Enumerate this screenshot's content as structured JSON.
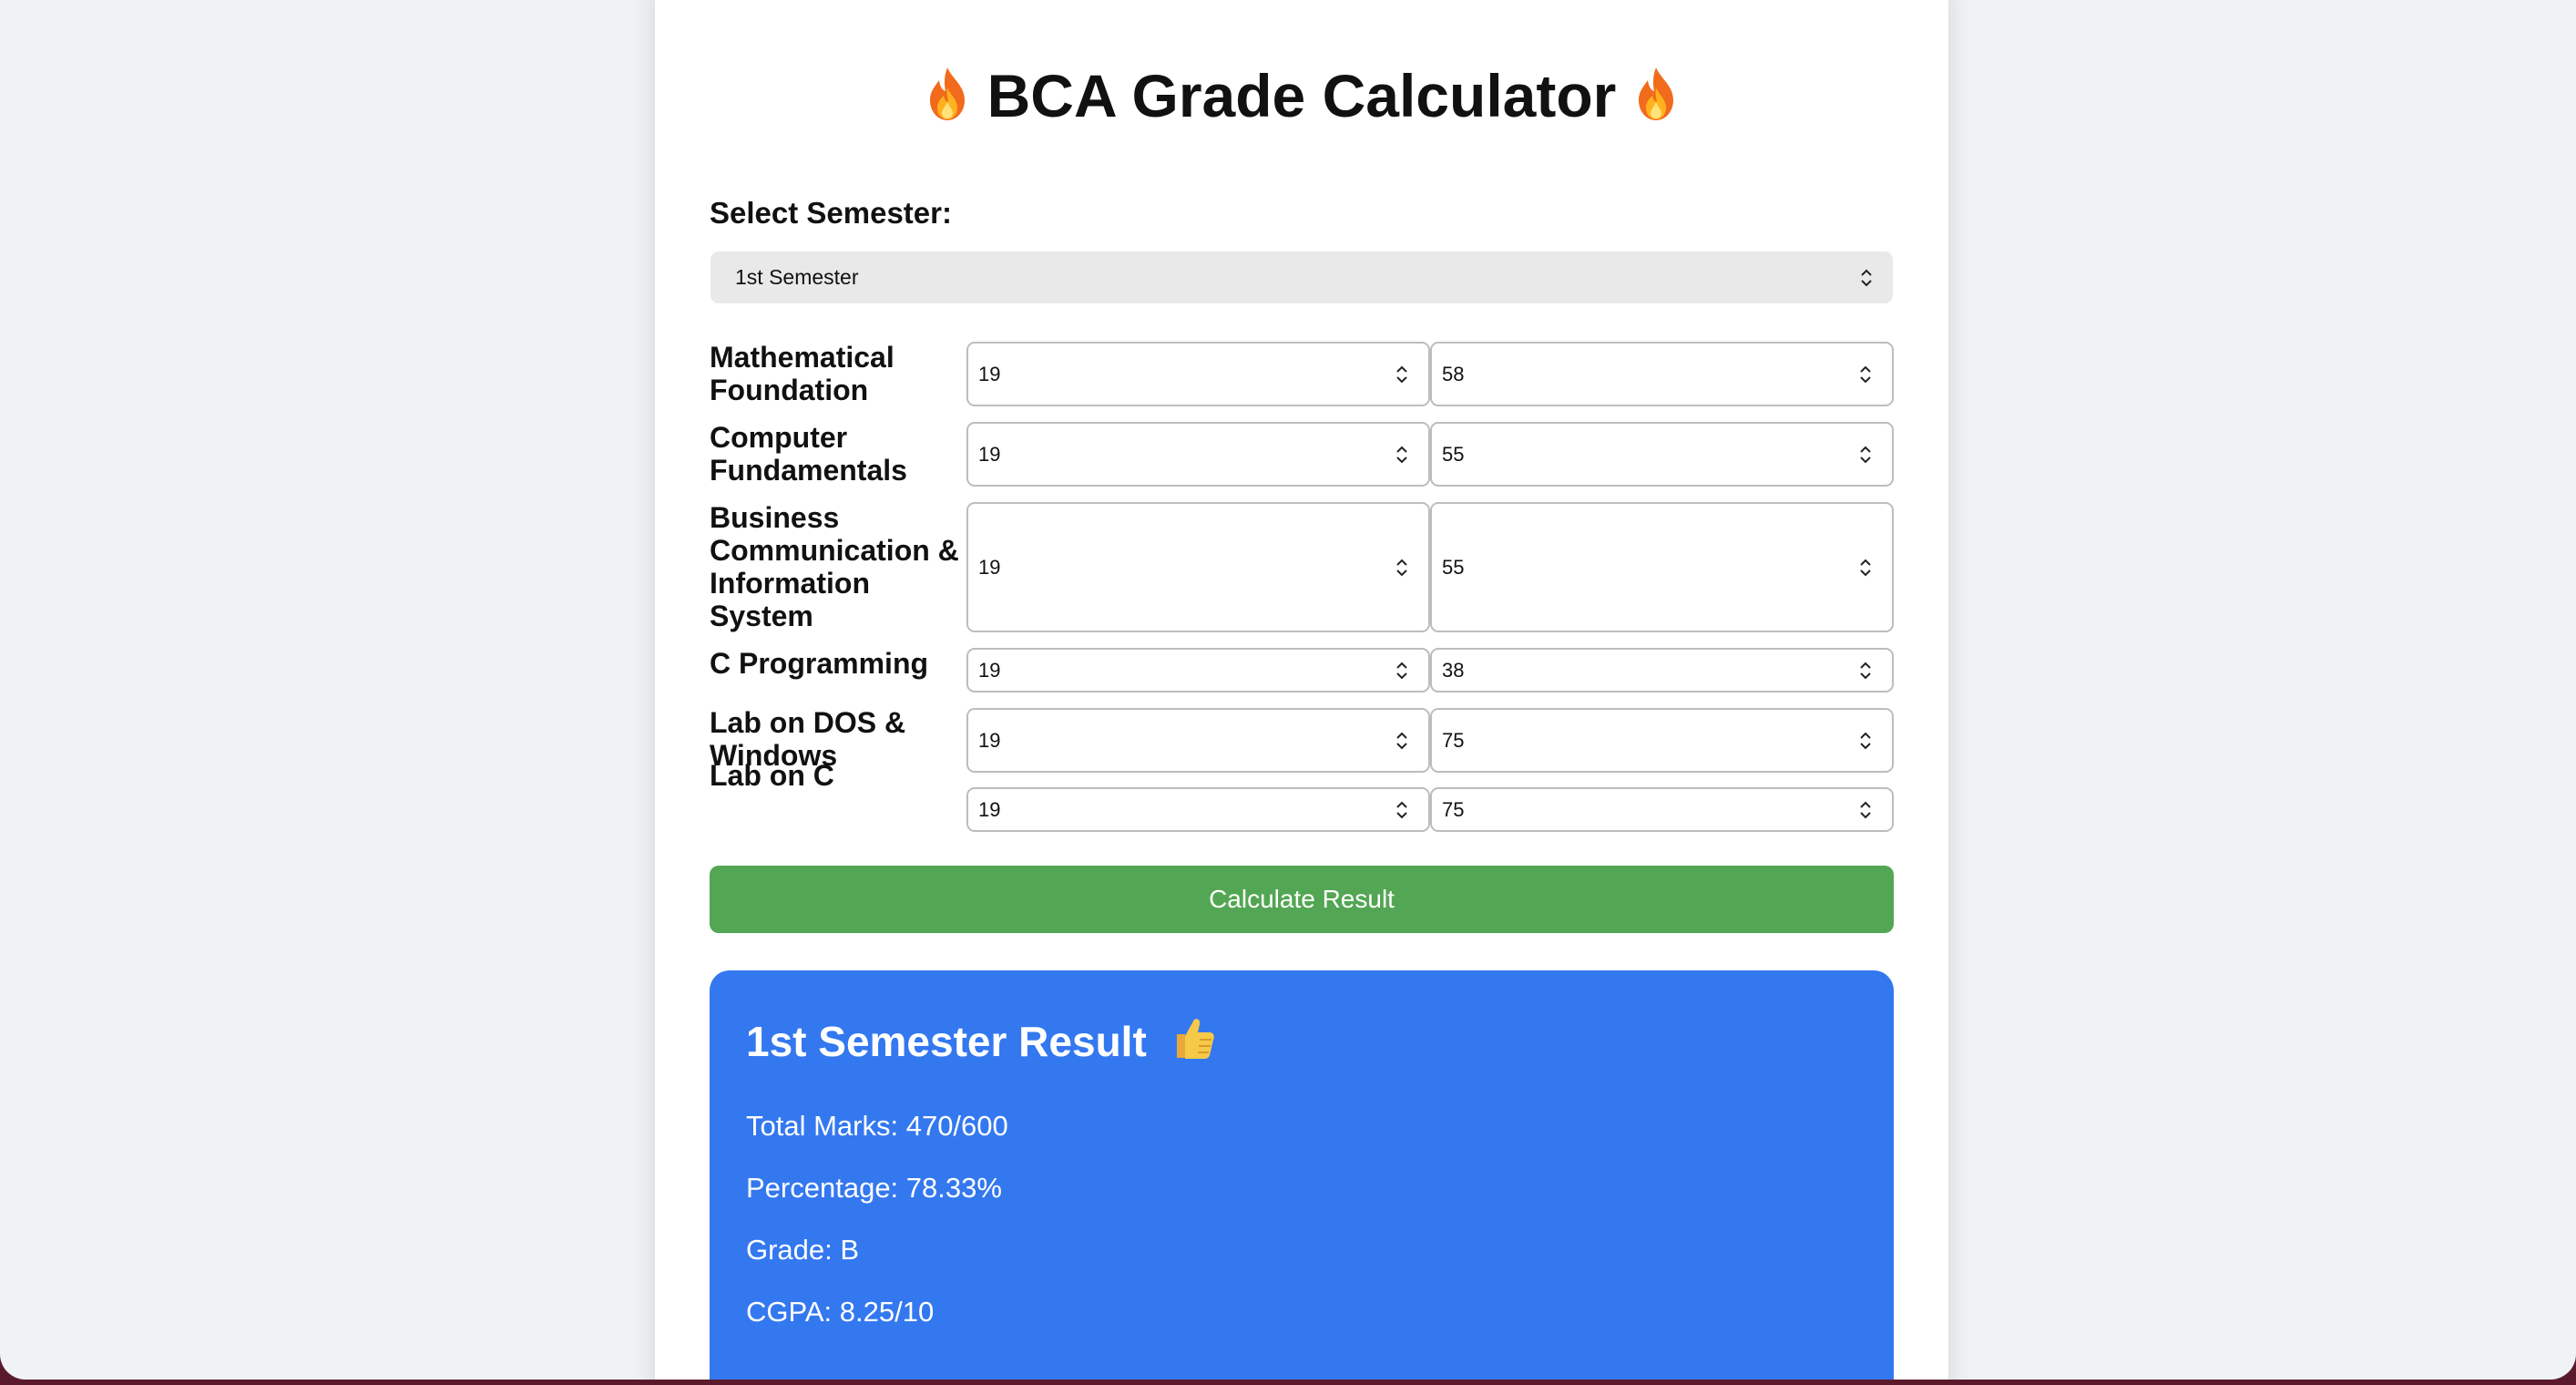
{
  "title": "BCA Grade Calculator",
  "semester": {
    "label": "Select Semester:",
    "selected": "1st Semester"
  },
  "subjects": [
    {
      "name": "Mathematical Foundation",
      "internal": "19",
      "external": "58"
    },
    {
      "name": "Computer Fundamentals",
      "internal": "19",
      "external": "55"
    },
    {
      "name": "Business Communication & Information System",
      "internal": "19",
      "external": "55"
    },
    {
      "name": "C Programming",
      "internal": "19",
      "external": "38"
    },
    {
      "name": "Lab on DOS & Windows",
      "internal": "19",
      "external": "75"
    },
    {
      "name": "Lab on C",
      "internal": "19",
      "external": "75"
    }
  ],
  "calculate_label": "Calculate Result",
  "result": {
    "title": "1st Semester Result",
    "total_marks": "Total Marks: 470/600",
    "percentage": "Percentage: 78.33%",
    "grade": "Grade: B",
    "cgpa": "CGPA: 8.25/10"
  },
  "icons": {
    "title_icon": "fire-icon",
    "result_icon": "thumbs-up-icon",
    "select_icon": "chevron-up-down-icon"
  },
  "colors": {
    "button": "#53a653",
    "result_bg": "#3478f0",
    "page_bg": "#eff3f6"
  }
}
